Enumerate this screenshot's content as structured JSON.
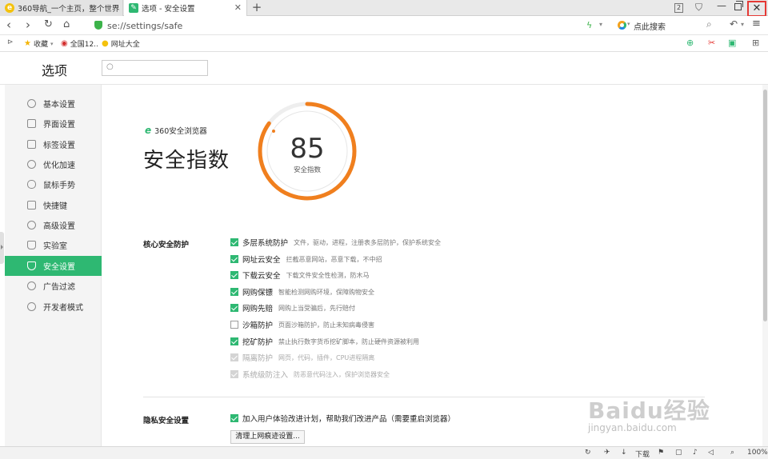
{
  "tabs": [
    {
      "title": "360导航_一个主页，整个世界"
    },
    {
      "title": "选项 - 安全设置"
    }
  ],
  "window": {
    "tab_count": "2"
  },
  "address": {
    "url": "se://settings/safe",
    "search_label": "点此搜索"
  },
  "bookmarks": [
    {
      "label": "收藏"
    },
    {
      "label": "全国12.."
    },
    {
      "label": "网址大全"
    }
  ],
  "options": {
    "title": "选项",
    "search_placeholder": ""
  },
  "sidebar": {
    "items": [
      {
        "label": "基本设置"
      },
      {
        "label": "界面设置"
      },
      {
        "label": "标签设置"
      },
      {
        "label": "优化加速"
      },
      {
        "label": "鼠标手势"
      },
      {
        "label": "快捷键"
      },
      {
        "label": "高级设置"
      },
      {
        "label": "实验室"
      },
      {
        "label": "安全设置"
      },
      {
        "label": "广告过滤"
      },
      {
        "label": "开发者模式"
      }
    ],
    "active_index": 8
  },
  "safety": {
    "brand": "360安全浏览器",
    "title": "安全指数",
    "score": 85,
    "score_label": "安全指数",
    "score_max": 100
  },
  "core": {
    "label": "核心安全防护",
    "items": [
      {
        "name": "多层系统防护",
        "desc": "文件，驱动，进程，注册表多层防护，保护系统安全",
        "checked": true
      },
      {
        "name": "网址云安全",
        "desc": "拦截恶意网站，恶意下载，不中招",
        "checked": true
      },
      {
        "name": "下载云安全",
        "desc": "下载文件安全性检测，防木马",
        "checked": true
      },
      {
        "name": "网购保镖",
        "desc": "智能检测网购环境，保障购物安全",
        "checked": true
      },
      {
        "name": "网购先赔",
        "desc": "网购上当受骗后，先行赔付",
        "checked": true
      },
      {
        "name": "沙箱防护",
        "desc": "页面沙箱防护，防止未知病毒侵害",
        "checked": false
      },
      {
        "name": "挖矿防护",
        "desc": "禁止执行数字货币挖矿脚本，防止硬件资源被利用",
        "checked": true
      },
      {
        "name": "隔离防护",
        "desc": "网页，代码，插件，CPU进程隔离",
        "checked": true,
        "disabled": true
      },
      {
        "name": "系统级防注入",
        "desc": "防恶意代码注入，保护浏览器安全",
        "checked": true,
        "disabled": true
      }
    ]
  },
  "privacy": {
    "label": "隐私安全设置",
    "item": "加入用户体验改进计划，帮助我们改进产品（需要重启浏览器）",
    "button": "清理上网痕迹设置..."
  },
  "watermark": {
    "main": "Baidu经验",
    "sub": "jingyan.baidu.com"
  },
  "status": {
    "download": "下载",
    "zoom": "100%"
  },
  "colors": {
    "accent": "#2eb872",
    "gauge": "#f07f1e",
    "close_highlight": "#e53935"
  }
}
